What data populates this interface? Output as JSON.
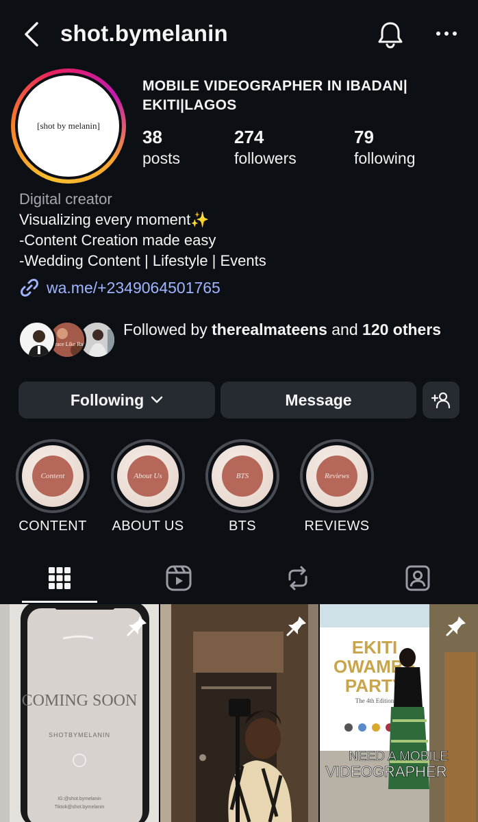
{
  "header": {
    "username": "shot.bymelanin"
  },
  "profile": {
    "avatar_text": "[shot by melanin]",
    "title": "MOBILE VIDEOGRAPHER IN IBADAN| EKITI|LAGOS",
    "stats": [
      {
        "value": "38",
        "label": "posts"
      },
      {
        "value": "274",
        "label": "followers"
      },
      {
        "value": "79",
        "label": "following"
      }
    ],
    "category": "Digital creator",
    "bio": [
      "Visualizing every moment✨",
      "-Content Creation made easy",
      "-Wedding Content | Lifestyle | Events"
    ],
    "link": "wa.me/+2349064501765"
  },
  "followed_by": {
    "prefix": "Followed by ",
    "name": "therealmateens",
    "middle": " and ",
    "others": "120 others",
    "avatar_text": "Grace Like Rain"
  },
  "actions": {
    "following_label": "Following",
    "message_label": "Message"
  },
  "highlights": [
    {
      "label": "CONTENT",
      "cover_text": "Content"
    },
    {
      "label": "ABOUT US",
      "cover_text": "About Us"
    },
    {
      "label": "BTS",
      "cover_text": "BTS"
    },
    {
      "label": "REVIEWS",
      "cover_text": "Reviews"
    }
  ],
  "posts": [
    {
      "title": "COMING SOON",
      "subtitle": "SHOTBYMELANIN",
      "footer1": "IG:@shot.bymelanin",
      "footer2": "Tiktok@shot.bymelanin"
    },
    {},
    {
      "banner1": "EKITI",
      "banner2": "OWAMBE",
      "banner3": "PARTY",
      "edition": "The 4th Edition",
      "caption1": "NEED A MOBILE",
      "caption2": "VIDEOGRAPHER"
    }
  ],
  "colors": {
    "background": "#0c0f14",
    "button": "#262a31",
    "link": "#a0b4ff",
    "muted": "#a6a9b0"
  }
}
